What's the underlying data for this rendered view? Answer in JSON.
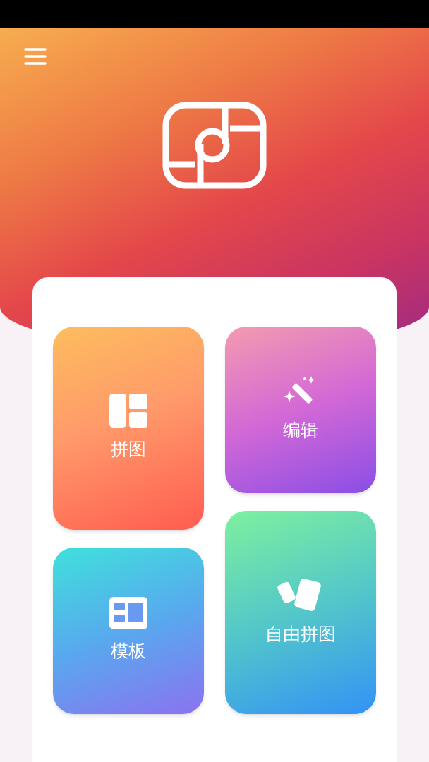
{
  "tiles": [
    {
      "kind": "collage",
      "label": "拼图"
    },
    {
      "kind": "edit",
      "label": "编辑"
    },
    {
      "kind": "template",
      "label": "模板"
    },
    {
      "kind": "free",
      "label": "自由拼图"
    }
  ]
}
